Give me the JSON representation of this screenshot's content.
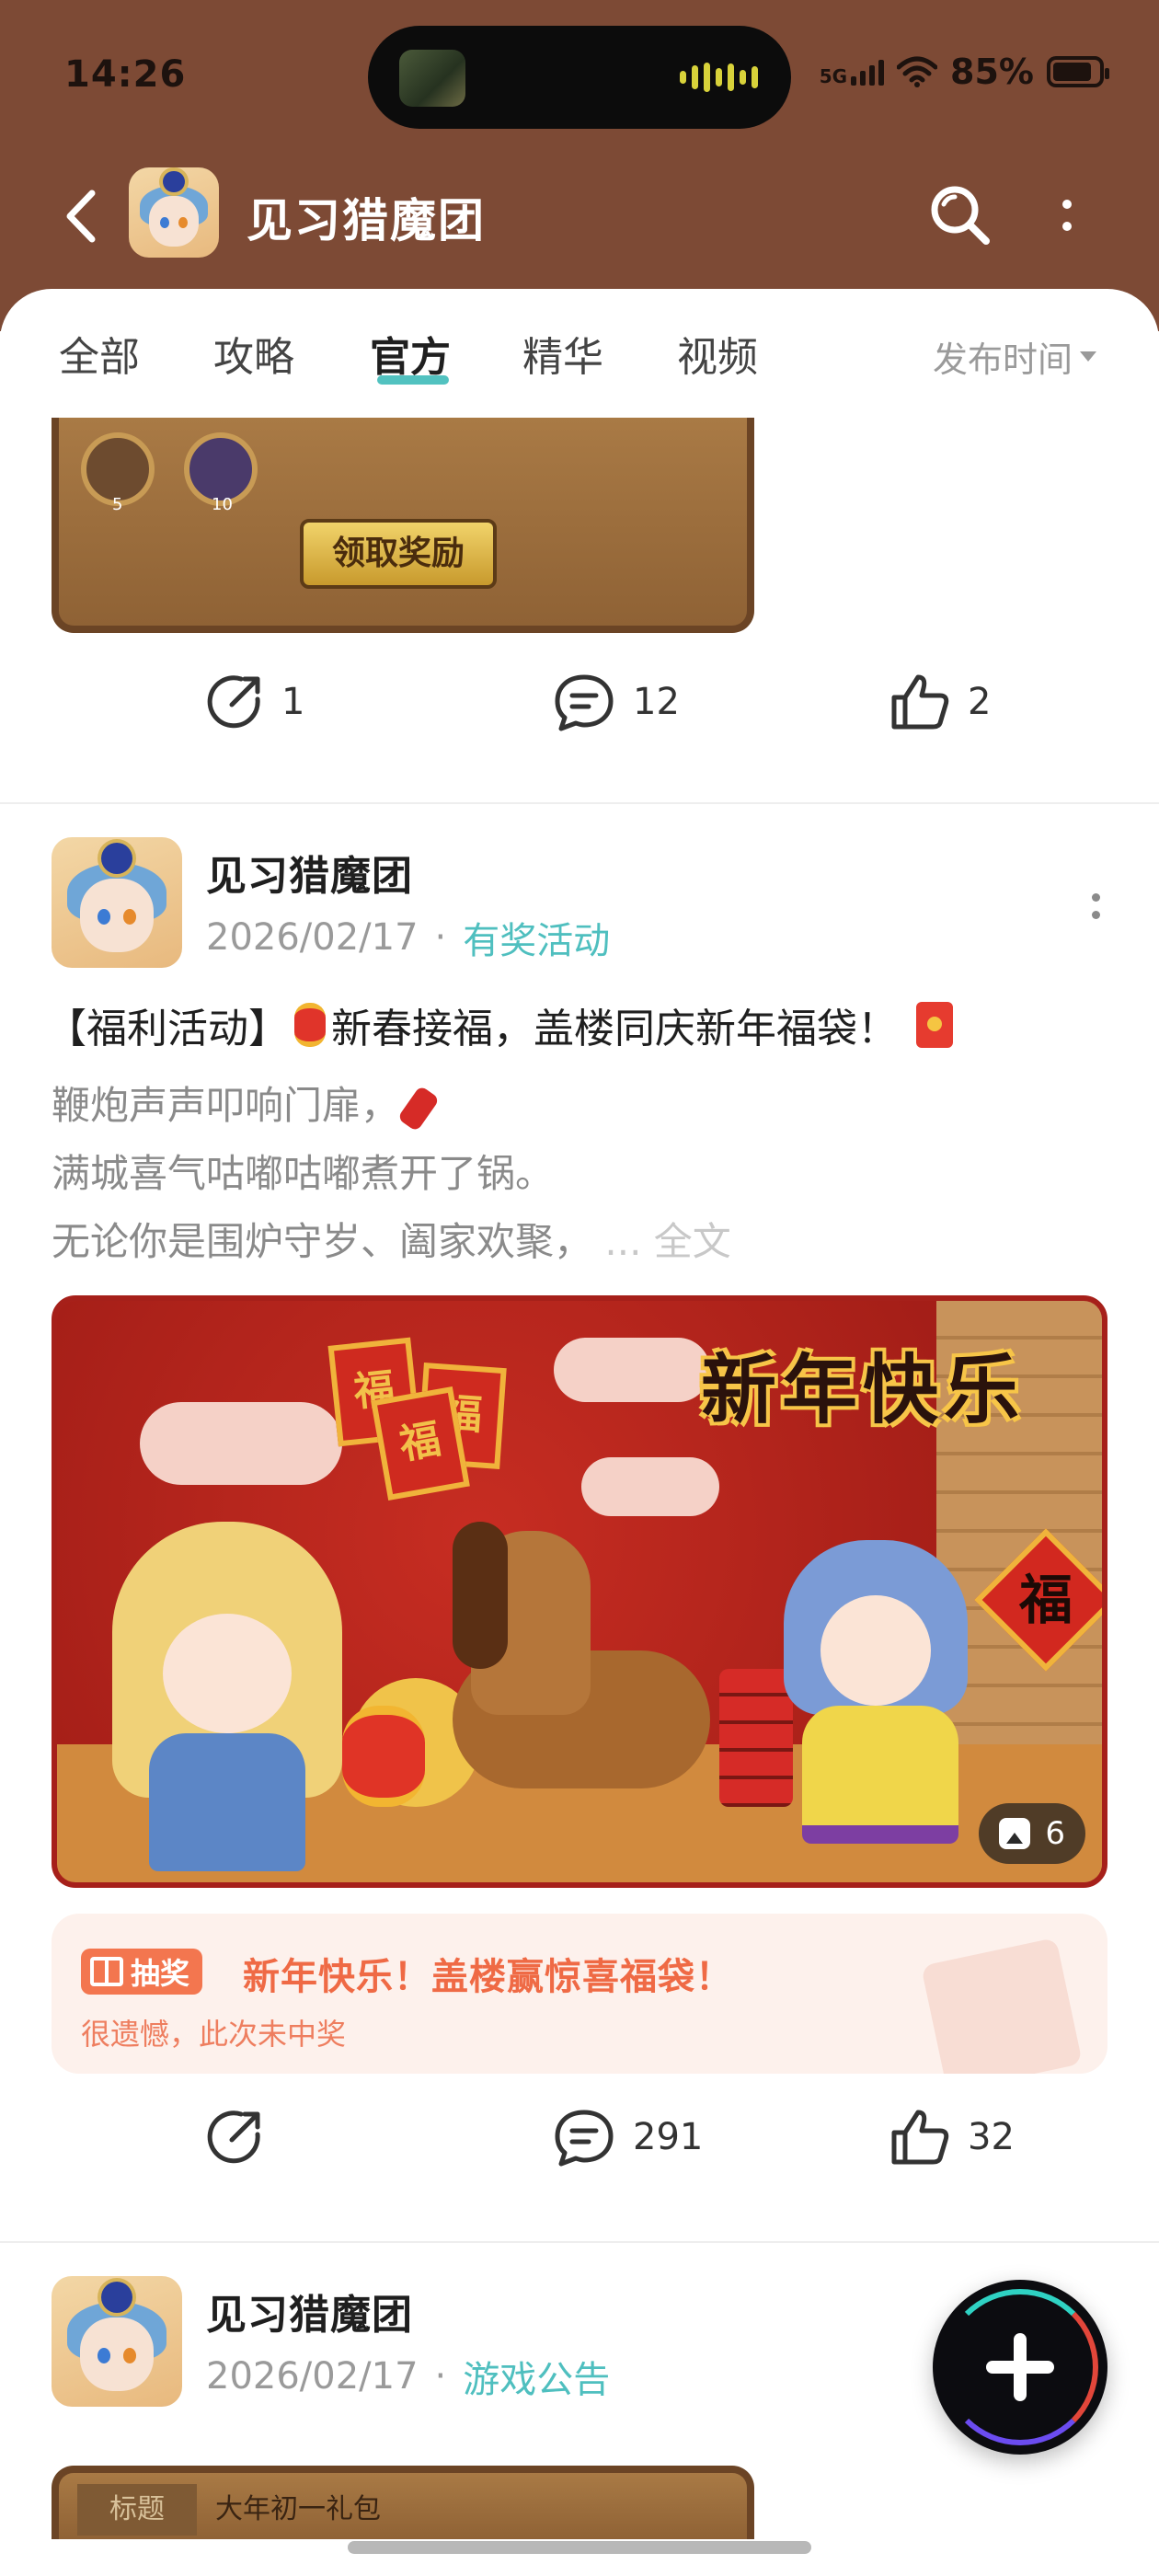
{
  "status_bar": {
    "time": "14:26",
    "network": "5G",
    "battery": "85%",
    "battery_level": 0.85
  },
  "header": {
    "title": "见习猎魔团",
    "back_icon": "chevron-left-icon",
    "search_icon": "search-icon",
    "more_icon": "more-vertical-icon"
  },
  "tabs": {
    "items": [
      "全部",
      "攻略",
      "官方",
      "精华",
      "视频"
    ],
    "active_index": 2,
    "sort_label": "发布时间"
  },
  "post1": {
    "claim_button": "领取奖励",
    "badge_counts": [
      "5",
      "10"
    ],
    "shares": "1",
    "comments": "12",
    "likes": "2"
  },
  "post2": {
    "author": "见习猎魔团",
    "date": "2026/02/17",
    "tag": "有奖活动",
    "title_prefix": "【福利活动】",
    "title_main": "新春接福，盖楼同庆新年福袋！",
    "line1": "鞭炮声声叩响门扉，",
    "line2": "满城喜气咕嘟咕嘟煮开了锅。",
    "line3": "无论你是围炉守岁、阖家欢聚，",
    "more": "... 全文",
    "banner_title": "新年快乐",
    "banner_fu": "福",
    "image_count": "6",
    "lottery_badge": "抽奖",
    "lottery_title": "新年快乐！盖楼赢惊喜福袋！",
    "lottery_result": "很遗憾，此次未中奖",
    "shares": "",
    "comments": "291",
    "likes": "32"
  },
  "post3": {
    "author": "见习猎魔团",
    "date": "2026/02/17",
    "tag": "游戏公告",
    "label": "标题",
    "label_value": "大年初一礼包"
  },
  "colors": {
    "header_bg": "#7d4a35",
    "accent_teal": "#4fbfbf",
    "lottery_orange": "#ef6a45"
  }
}
